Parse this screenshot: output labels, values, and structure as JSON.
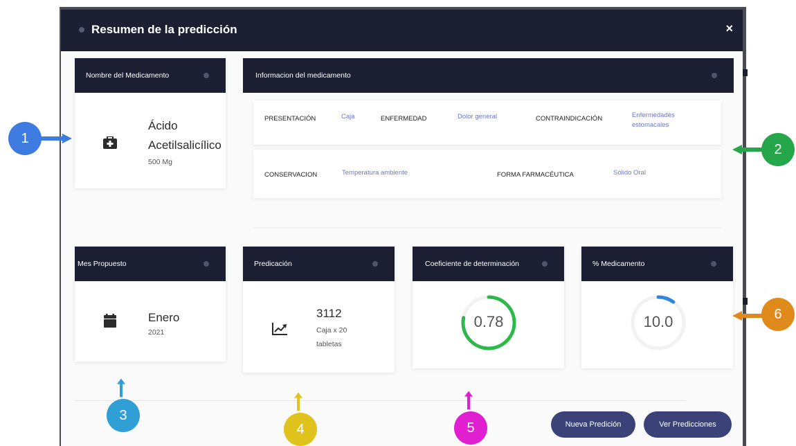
{
  "modal": {
    "title": "Resumen de la predicción",
    "close": "×"
  },
  "medicine_card": {
    "header": "Nombre del Medicamento",
    "name_line1": "Ácido",
    "name_line2": "Acetilsalicílico",
    "dose": "500 Mg"
  },
  "info_card": {
    "header": "Informacion del medicamento",
    "presentacion_label": "PRESENTACIÓN",
    "presentacion_value": "Caja",
    "enfermedad_label": "ENFERMEDAD",
    "enfermedad_value": "Dolor general",
    "contraindicacion_label": "CONTRAINDICACIÓN",
    "contraindicacion_value1": "Enfermedades",
    "contraindicacion_value2": "estomacales",
    "conservacion_label": "CONSERVACION",
    "conservacion_value": "Temperatura ambiente",
    "forma_label": "FORMA FARMACÉUTICA",
    "forma_value": "Sólido Oral"
  },
  "month_card": {
    "header": "Mes Propuesto",
    "month": "Enero",
    "year": "2021"
  },
  "prediction_card": {
    "header": "Predicación",
    "value": "3112",
    "unit1": "Caja x 20",
    "unit2": "tabletas"
  },
  "coef_card": {
    "header": "Coeficiente de determinación",
    "value": "0.78",
    "fraction": 0.78,
    "color": "#2db84a"
  },
  "percent_card": {
    "header": "% Medicamento",
    "value": "10.0",
    "fraction": 0.1,
    "color": "#2f86e0"
  },
  "buttons": {
    "new": "Nueva Predición",
    "view": "Ver Predicciones"
  },
  "annotations": {
    "b1": "1",
    "b2": "2",
    "b3": "3",
    "b4": "4",
    "b5": "5",
    "b6": "6",
    "c1": "#3d7be0",
    "c2": "#26a64a",
    "c3": "#2f9fd6",
    "c4": "#e0c31c",
    "c5": "#e020d0",
    "c6": "#e08a1c"
  }
}
